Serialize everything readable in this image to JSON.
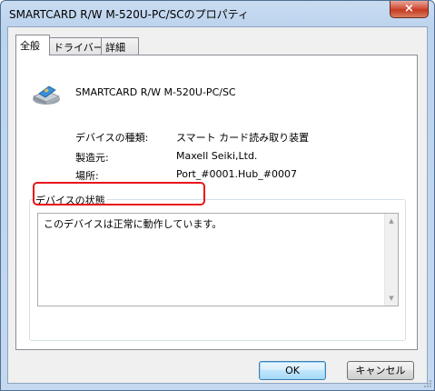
{
  "window": {
    "title": "SMARTCARD R/W M-520U-PC/SCのプロパティ",
    "close_icon": "×"
  },
  "tabs": [
    {
      "label": "全般",
      "active": true
    },
    {
      "label": "ドライバー",
      "active": false
    },
    {
      "label": "詳細",
      "active": false
    }
  ],
  "device": {
    "icon": "smartcard-reader-icon",
    "name": "SMARTCARD R/W M-520U-PC/SC"
  },
  "properties": [
    {
      "label": "デバイスの種類:",
      "value": "スマート カード読み取り装置"
    },
    {
      "label": "製造元:",
      "value": "Maxell Seiki,Ltd."
    },
    {
      "label": "場所:",
      "value": "Port_#0001.Hub_#0007"
    }
  ],
  "status_group": {
    "label": "デバイスの状態",
    "text": "このデバイスは正常に動作しています。"
  },
  "buttons": {
    "ok": "OK",
    "cancel": "キャンセル"
  },
  "colors": {
    "highlight": "#e8141b",
    "frame": "#c4d9f0",
    "close": "#c53a22"
  }
}
